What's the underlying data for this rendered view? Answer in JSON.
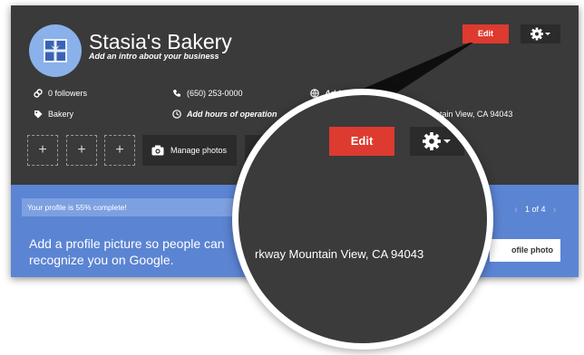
{
  "business": {
    "name": "Stasia's Bakery",
    "intro_prompt": "Add an intro about your business"
  },
  "header_buttons": {
    "edit_label": "Edit",
    "settings_icon": "gear-icon"
  },
  "info": {
    "followers": "0 followers",
    "phone": "(650) 253-0000",
    "website_partial": "Add",
    "category": "Bakery",
    "hours_prompt": "Add hours of operation",
    "address_partial": "ntain View, CA 94043"
  },
  "photos": {
    "placeholder_glyph": "+",
    "manage_label": "Manage photos"
  },
  "profile": {
    "progress_text": "Your profile is 55% complete!",
    "progress_percent": 55,
    "pager_text": "1 of 4",
    "prev_glyph": "‹",
    "next_glyph": "›",
    "promo_text": "Add a profile picture so people can recognize you on Google.",
    "promo_button_partial": "ofile photo"
  },
  "zoom": {
    "edit_label": "Edit",
    "address_text": "rkway Mountain View, CA 94043"
  },
  "colors": {
    "dark_header": "#3a3a3a",
    "accent_red": "#dd3a30",
    "blue_panel": "#5b84d3",
    "avatar_blue": "#8ab1ea"
  }
}
